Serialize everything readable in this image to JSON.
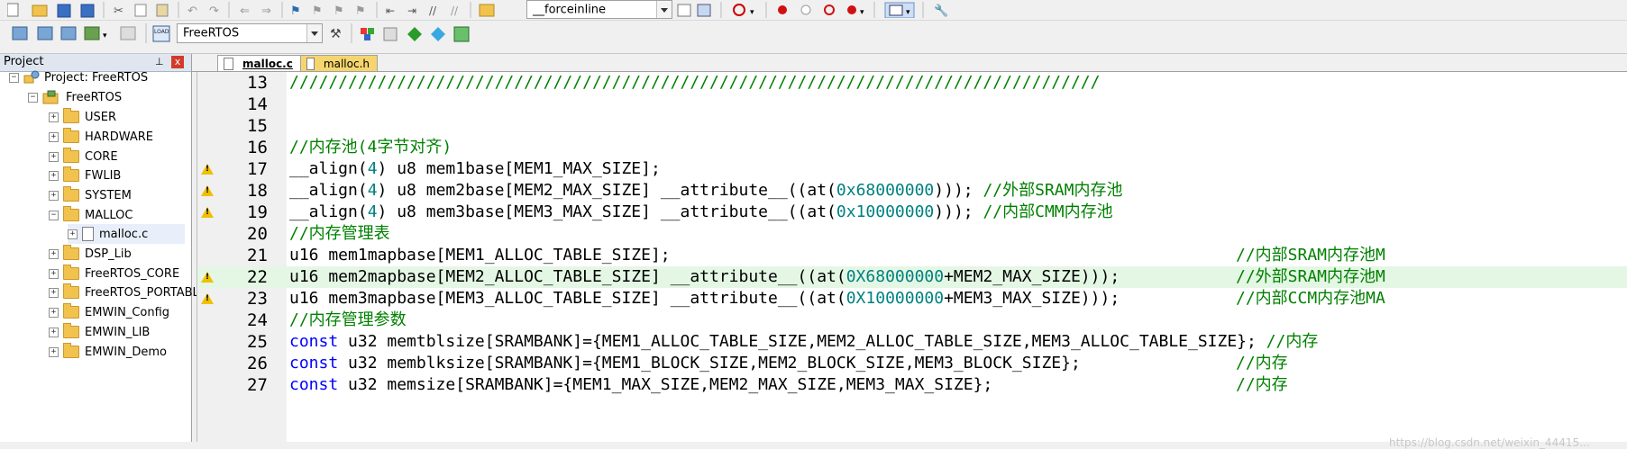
{
  "toolbar_top": {
    "target_combo": "__forceinline"
  },
  "toolbar_second": {
    "target_combo": "FreeRTOS"
  },
  "project_panel": {
    "title": "Project",
    "pin_glyph": "ᵖ",
    "close_glyph": "x",
    "items": [
      {
        "label": "Project: FreeRTOS",
        "exp": "−"
      },
      {
        "label": "FreeRTOS",
        "exp": "−"
      },
      {
        "label": "USER",
        "exp": "+"
      },
      {
        "label": "HARDWARE",
        "exp": "+"
      },
      {
        "label": "CORE",
        "exp": "+"
      },
      {
        "label": "FWLIB",
        "exp": "+"
      },
      {
        "label": "SYSTEM",
        "exp": "+"
      },
      {
        "label": "MALLOC",
        "exp": "−"
      },
      {
        "label": "malloc.c",
        "exp": "+"
      },
      {
        "label": "DSP_Lib",
        "exp": "+"
      },
      {
        "label": "FreeRTOS_CORE",
        "exp": "+"
      },
      {
        "label": "FreeRTOS_PORTABLI",
        "exp": "+"
      },
      {
        "label": "EMWIN_Config",
        "exp": "+"
      },
      {
        "label": "EMWIN_LIB",
        "exp": "+"
      },
      {
        "label": "EMWIN_Demo",
        "exp": "+"
      }
    ]
  },
  "tabs": [
    "malloc.c",
    "malloc.h"
  ],
  "code_lines": [
    {
      "n": "13",
      "text": "///////////////////////////////////////////////////////////////////////////////////"
    },
    {
      "n": "14",
      "text": ""
    },
    {
      "n": "15",
      "text": ""
    },
    {
      "n": "16",
      "text": "//内存池(4字节对齐)"
    },
    {
      "n": "17",
      "text": "__align(4) u8 mem1base[MEM1_MAX_SIZE];"
    },
    {
      "n": "18",
      "text": "__align(4) u8 mem2base[MEM2_MAX_SIZE] __attribute__((at(0x68000000))); //外部SRAM内存池"
    },
    {
      "n": "19",
      "text": "__align(4) u8 mem3base[MEM3_MAX_SIZE] __attribute__((at(0x10000000))); //内部CMM内存池"
    },
    {
      "n": "20",
      "text": "//内存管理表"
    },
    {
      "n": "21",
      "text": "u16 mem1mapbase[MEM1_ALLOC_TABLE_SIZE];",
      "trail": "//内部SRAM内存池M"
    },
    {
      "n": "22",
      "text": "u16 mem2mapbase[MEM2_ALLOC_TABLE_SIZE] __attribute__((at(0X68000000+MEM2_MAX_SIZE)));",
      "trail": "//外部SRAM内存池M"
    },
    {
      "n": "23",
      "text": "u16 mem3mapbase[MEM3_ALLOC_TABLE_SIZE] __attribute__((at(0X10000000+MEM3_MAX_SIZE)));",
      "trail": "//内部CCM内存池MA"
    },
    {
      "n": "24",
      "text": "//内存管理参数"
    },
    {
      "n": "25",
      "text": "const u32 memtblsize[SRAMBANK]={MEM1_ALLOC_TABLE_SIZE,MEM2_ALLOC_TABLE_SIZE,MEM3_ALLOC_TABLE_SIZE}; //内存"
    },
    {
      "n": "26",
      "text": "const u32 memblksize[SRAMBANK]={MEM1_BLOCK_SIZE,MEM2_BLOCK_SIZE,MEM3_BLOCK_SIZE};",
      "trail": "                    //内存"
    },
    {
      "n": "27",
      "text": "const u32 memsize[SRAMBANK]={MEM1_MAX_SIZE,MEM2_MAX_SIZE,MEM3_MAX_SIZE};",
      "trail": "//内存"
    }
  ],
  "watermark": "https://blog.csdn.net/weixin_44415..."
}
